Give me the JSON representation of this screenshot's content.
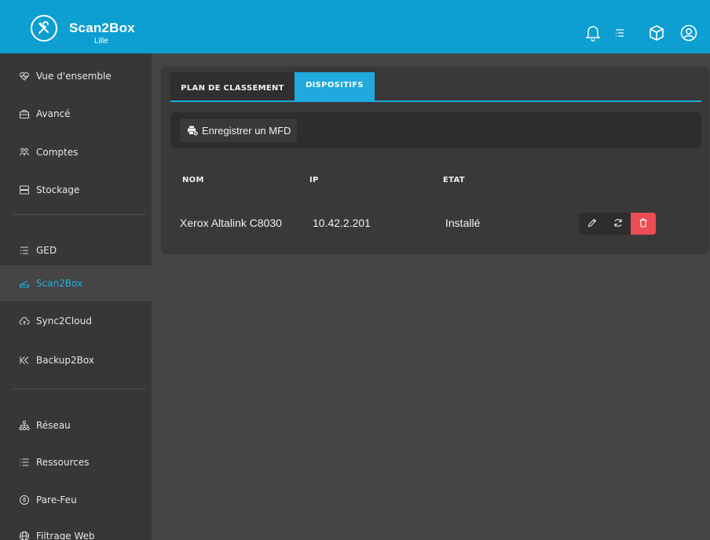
{
  "header": {
    "app_name": "Scan2Box",
    "site": "Lille",
    "icons": [
      "tools-logo-icon",
      "bell-icon",
      "list-icon",
      "box-icon",
      "user-circle-icon"
    ]
  },
  "sidebar": {
    "items": [
      {
        "label": "Vue d'ensemble",
        "icon": "heart-pulse-icon"
      },
      {
        "label": "Avancé",
        "icon": "toolbox-icon"
      },
      {
        "label": "Comptes",
        "icon": "users-icon"
      },
      {
        "label": "Stockage",
        "icon": "storage-icon"
      },
      {
        "label": "GED",
        "icon": "list-check-icon"
      },
      {
        "label": "Scan2Box",
        "icon": "scan-icon",
        "active": true
      },
      {
        "label": "Sync2Cloud",
        "icon": "cloud-upload-icon"
      },
      {
        "label": "Backup2Box",
        "icon": "rewind-icon"
      },
      {
        "label": "Réseau",
        "icon": "network-icon"
      },
      {
        "label": "Ressources",
        "icon": "list-icon"
      },
      {
        "label": "Pare-Feu",
        "icon": "firewall-icon"
      },
      {
        "label": "Filtrage Web",
        "icon": "globe-icon"
      }
    ]
  },
  "tabs": [
    {
      "label": "PLAN DE CLASSEMENT",
      "active": false
    },
    {
      "label": "DISPOSITIFS",
      "active": true
    }
  ],
  "toolbar": {
    "register_label": "Enregistrer un MFD"
  },
  "table": {
    "columns": [
      "NOM",
      "IP",
      "ETAT"
    ],
    "rows": [
      {
        "nom": "Xerox Altalink C8030",
        "ip": "10.42.2.201",
        "etat": "Installé"
      }
    ]
  },
  "colors": {
    "accent": "#1fa9dc",
    "header": "#0d9fd1",
    "danger": "#ec4c53",
    "sidebar": "#373737",
    "main": "#454545"
  }
}
